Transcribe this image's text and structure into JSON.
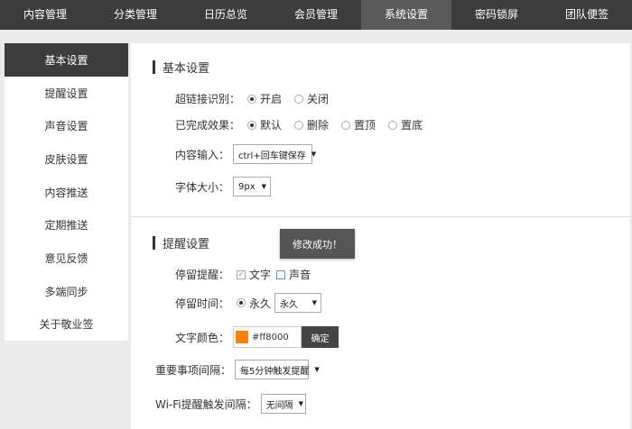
{
  "nav": {
    "tabs": [
      {
        "label": "内容管理"
      },
      {
        "label": "分类管理"
      },
      {
        "label": "日历总览"
      },
      {
        "label": "会员管理"
      },
      {
        "label": "系统设置",
        "active": true
      },
      {
        "label": "密码锁屏"
      },
      {
        "label": "团队便签"
      }
    ]
  },
  "sidebar": {
    "items": [
      {
        "label": "基本设置",
        "active": true
      },
      {
        "label": "提醒设置"
      },
      {
        "label": "声音设置"
      },
      {
        "label": "皮肤设置"
      },
      {
        "label": "内容推送"
      },
      {
        "label": "定期推送"
      },
      {
        "label": "意见反馈"
      },
      {
        "label": "多端同步"
      },
      {
        "label": "关于敬业签"
      }
    ]
  },
  "basic": {
    "title": "基本设置",
    "hyperlink": {
      "label": "超链接识别：",
      "options": [
        "开启",
        "关闭"
      ],
      "selected": "开启"
    },
    "completed": {
      "label": "已完成效果：",
      "options": [
        "默认",
        "删除",
        "置顶",
        "置底"
      ],
      "selected": "默认"
    },
    "input": {
      "label": "内容输入：",
      "value": "ctrl+回车键保存"
    },
    "fontsize": {
      "label": "字体大小：",
      "value": "9px"
    }
  },
  "reminder": {
    "title": "提醒设置",
    "toast": "修改成功！",
    "stay_remind": {
      "label": "停留提醒：",
      "options": [
        "文字",
        "声音"
      ],
      "checked": [
        "文字"
      ]
    },
    "stay_time": {
      "label": "停留时间：",
      "radio_label": "永久",
      "select_value": "永久"
    },
    "text_color": {
      "label": "文字颜色：",
      "value": "#ff8000",
      "confirm": "确定",
      "swatch": "#ff8000"
    },
    "important_interval": {
      "label": "重要事项间隔：",
      "value": "每5分钟触发提醒"
    },
    "wifi_interval": {
      "label": "Wi-Fi提醒触发间隔：",
      "value": "无间隔"
    }
  }
}
